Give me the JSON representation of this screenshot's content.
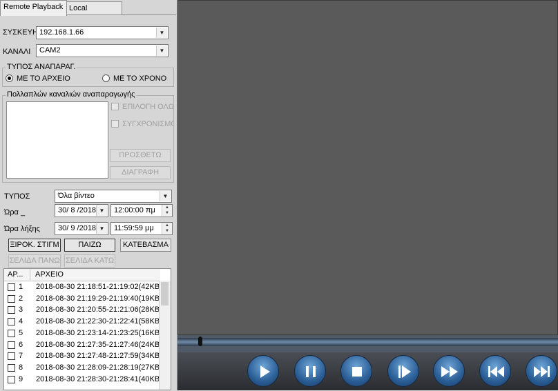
{
  "tabs": [
    {
      "label": "Remote Playback",
      "active": true
    },
    {
      "label": "Local Playback",
      "active": false
    }
  ],
  "device": {
    "label": "ΣΥΣΚΕΥΗ",
    "value": "192.168.1.66"
  },
  "channel": {
    "label": "ΚΑΝΑΛΙ",
    "value": "CAM2"
  },
  "playback_type": {
    "title": "ΤΥΠΟΣ ΑΝΑΠΑΡΑΓ.",
    "options": [
      {
        "label": "ΜΕ ΤΟ ΑΡΧΕΙΟ",
        "selected": true
      },
      {
        "label": "ΜΕ ΤΟ ΧΡΟΝΟ",
        "selected": false
      }
    ]
  },
  "multi_channel": {
    "title": "Πολλαπλών καναλιών αναπαραγωγής",
    "select_all_label": "ΕΠΙΛΟΓΗ ΟΛΩ",
    "sync_label": "ΣΥΓΧΡΟΝΙΣΜΟ",
    "add_label": "ΠΡΟΣΘΕΤΩ",
    "delete_label": "ΔΙΑΓΡΑΦΗ"
  },
  "filter": {
    "type_label": "ΤΥΠΟΣ",
    "type_value": "Όλα βίντεο",
    "start_label": "Ώρα _",
    "start_date": "30/ 8 /2018",
    "start_time": "12:00:00 πμ",
    "end_label": "Ώρα λήξης",
    "end_date": "30/ 9 /2018",
    "end_time": "11:59:59 μμ"
  },
  "actions": {
    "snapshot_label": "ΞΙΡΟΚ. ΣΤΙΓΜ",
    "play_label": "ΠΑΙΖΩ",
    "download_label": "ΚΑΤΕΒΑΣΜΑ",
    "page_up_label": "ΣΕΛΙΔΑ ΠΑΝΩ",
    "page_down_label": "ΣΕΛΙΔΑ ΚΑΤΩ"
  },
  "file_list": {
    "col_num": "ΑΡ...",
    "col_file": "ΑΡΧΕΙΟ",
    "rows": [
      {
        "num": "1",
        "file": "2018-08-30 21:18:51-21:19:02(42KB"
      },
      {
        "num": "2",
        "file": "2018-08-30 21:19:29-21:19:40(19KB"
      },
      {
        "num": "3",
        "file": "2018-08-30 21:20:55-21:21:06(28KB"
      },
      {
        "num": "4",
        "file": "2018-08-30 21:22:30-21:22:41(58KB"
      },
      {
        "num": "5",
        "file": "2018-08-30 21:23:14-21:23:25(16KB"
      },
      {
        "num": "6",
        "file": "2018-08-30 21:27:35-21:27:46(24KB"
      },
      {
        "num": "7",
        "file": "2018-08-30 21:27:48-21:27:59(34KB"
      },
      {
        "num": "8",
        "file": "2018-08-30 21:28:09-21:28:19(27KB"
      },
      {
        "num": "9",
        "file": "2018-08-30 21:28:30-21:28:41(40KB"
      }
    ]
  },
  "player": {
    "progress_fraction": 0.0,
    "buttons": [
      "play-icon",
      "pause-icon",
      "stop-icon",
      "step-forward-icon",
      "fast-forward-icon",
      "rewind-icon",
      "skip-forward-icon"
    ]
  }
}
